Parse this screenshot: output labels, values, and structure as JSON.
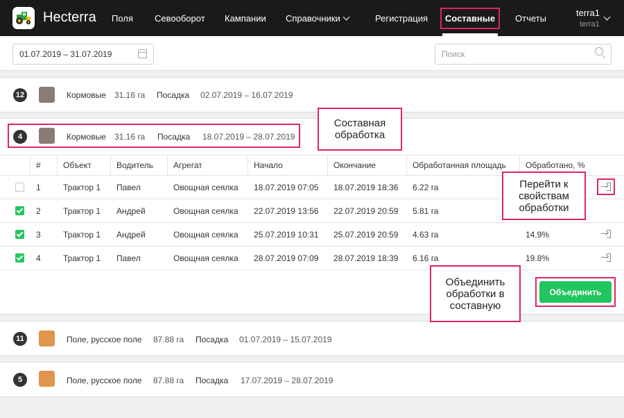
{
  "app": {
    "title": "Hecterra",
    "logo": "tractor-logo-icon"
  },
  "nav": {
    "items": [
      "Поля",
      "Севооборот",
      "Кампании",
      "Справочники",
      "Регистрация",
      "Составные",
      "Отчеты"
    ],
    "active": "Составные"
  },
  "user": {
    "name": "terra1",
    "login": "terra1"
  },
  "toolbar": {
    "date_range": "01.07.2019 – 31.07.2019",
    "search_placeholder": "Поиск"
  },
  "groups": [
    {
      "num": "12",
      "color": "#8a7a78",
      "crop": "Кормовые",
      "area": "31.16 га",
      "op": "Посадка",
      "period": "02.07.2019 – 16.07.2019"
    },
    {
      "num": "4",
      "color": "#8a7a78",
      "crop": "Кормовые",
      "area": "31.16 га",
      "op": "Посадка",
      "period": "18.07.2019 – 28.07.2019"
    },
    {
      "num": "11",
      "color": "#e0944c",
      "crop": "Поле, русское поле",
      "area": "87.88 га",
      "op": "Посадка",
      "period": "01.07.2019 – 15.07.2019"
    },
    {
      "num": "5",
      "color": "#e0944c",
      "crop": "Поле, русское поле",
      "area": "87.88 га",
      "op": "Посадка",
      "period": "17.07.2019 – 28.07.2019"
    }
  ],
  "table": {
    "headers": [
      "#",
      "Объект",
      "Водитель",
      "Агрегат",
      "Начало",
      "Окончание",
      "Обработанная площадь",
      "Обработано, %"
    ],
    "rows": [
      {
        "checked": false,
        "cells": [
          "1",
          "Трактор 1",
          "Павел",
          "Овощная сеялка",
          "18.07.2019 07:05",
          "18.07.2019 18:36",
          "6.22 га",
          ""
        ]
      },
      {
        "checked": true,
        "cells": [
          "2",
          "Трактор 1",
          "Андрей",
          "Овощная сеялка",
          "22.07.2019 13:56",
          "22.07.2019 20:59",
          "5.81 га",
          ""
        ]
      },
      {
        "checked": true,
        "cells": [
          "3",
          "Трактор 1",
          "Андрей",
          "Овощная сеялка",
          "25.07.2019 10:31",
          "25.07.2019 20:59",
          "4.63 га",
          "14.9%"
        ]
      },
      {
        "checked": true,
        "cells": [
          "4",
          "Трактор 1",
          "Павел",
          "Овощная сеялка",
          "28.07.2019 07:09",
          "28.07.2019 18:39",
          "6.16 га",
          "19.8%"
        ]
      }
    ]
  },
  "merge_button": "Объединить",
  "callouts": {
    "composite": [
      "Составная",
      "обработка"
    ],
    "goto": [
      "Перейти к",
      "свойствам",
      "обработки"
    ],
    "merge": [
      "Объединить",
      "обработки в",
      "составную"
    ]
  },
  "colors": {
    "accent": "#22c55e",
    "highlight": "#e0245e",
    "navbar": "#1a1a1a"
  }
}
